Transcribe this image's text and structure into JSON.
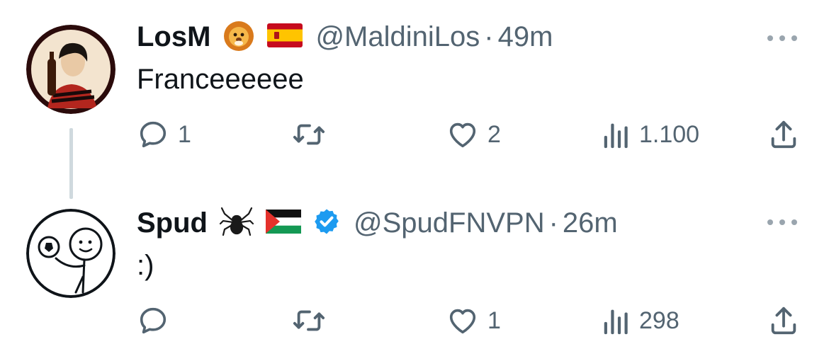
{
  "tweets": [
    {
      "name": "LosM",
      "handle": "@MaldiniLos",
      "separator": "·",
      "time": "49m",
      "text": "Franceeeeee",
      "avatar_icon": "man-with-bottle-avatar",
      "badges": [
        "lion-emoji",
        "spain-flag-emoji"
      ],
      "counts": {
        "replies": "1",
        "retweets": "",
        "likes": "2",
        "views": "1.100"
      }
    },
    {
      "name": "Spud",
      "handle": "@SpudFNVPN",
      "separator": "·",
      "time": "26m",
      "text": ":)",
      "avatar_icon": "stick-figure-football-avatar",
      "badges": [
        "spider-emoji",
        "palestine-flag-emoji",
        "verified-badge"
      ],
      "counts": {
        "replies": "",
        "retweets": "",
        "likes": "1",
        "views": "298"
      }
    }
  ],
  "colors": {
    "text": "#0f1419",
    "secondary": "#536471",
    "verified": "#1d9bf0",
    "thread_line": "#cfd9de"
  }
}
